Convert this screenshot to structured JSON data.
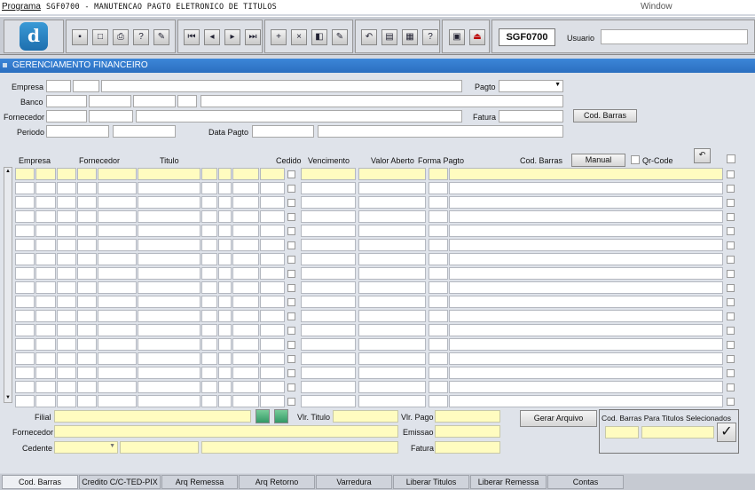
{
  "titlebar": {
    "program": "Programa",
    "title": "SGF0700 - MANUTENCAO PAGTO ELETRONICO DE TITULOS",
    "window": "Window"
  },
  "toolbar": {
    "form_code": "SGF0700",
    "usuario_label": "Usuario",
    "usuario_value": ""
  },
  "panel": {
    "title": "GERENCIAMENTO FINANCEIRO"
  },
  "filters": {
    "empresa": "Empresa",
    "banco": "Banco",
    "fornecedor": "Fornecedor",
    "periodo": "Periodo",
    "pagto": "Pagto",
    "fatura": "Fatura",
    "data_pagto": "Data Pagto",
    "cod_barras_button": "Cod. Barras"
  },
  "grid": {
    "headers": {
      "empresa": "Empresa",
      "fornecedor": "Fornecedor",
      "titulo": "Titulo",
      "cedido": "Cedido",
      "vencimento": "Vencimento",
      "valor_aberto": "Valor Aberto",
      "forma_pagto": "Forma Pagto",
      "cod_barras": "Cod. Barras"
    },
    "manual_button": "Manual",
    "qr_label": "Qr-Code",
    "row_count": 17
  },
  "bottom": {
    "filial": "Filial",
    "fornecedor": "Fornecedor",
    "cedente": "Cedente",
    "vlr_titulo": "Vlr. Titulo",
    "vlr_pago": "Vlr. Pago",
    "emissao": "Emissao",
    "fatura": "Fatura",
    "gerar_arquivo": "Gerar Arquivo",
    "cod_barras_selecionados": "Cod. Barras Para Titulos Selecionados"
  },
  "tabs": [
    "Cod. Barras",
    "Credito C/C-TED-PIX",
    "Arq Remessa",
    "Arq Retorno",
    "Varredura",
    "Liberar Titulos",
    "Liberar Remessa",
    "Contas"
  ],
  "active_tab": "Cod. Barras",
  "colors": {
    "panel_header": "#2b6fc0",
    "yellow_field": "#fffcc0"
  }
}
